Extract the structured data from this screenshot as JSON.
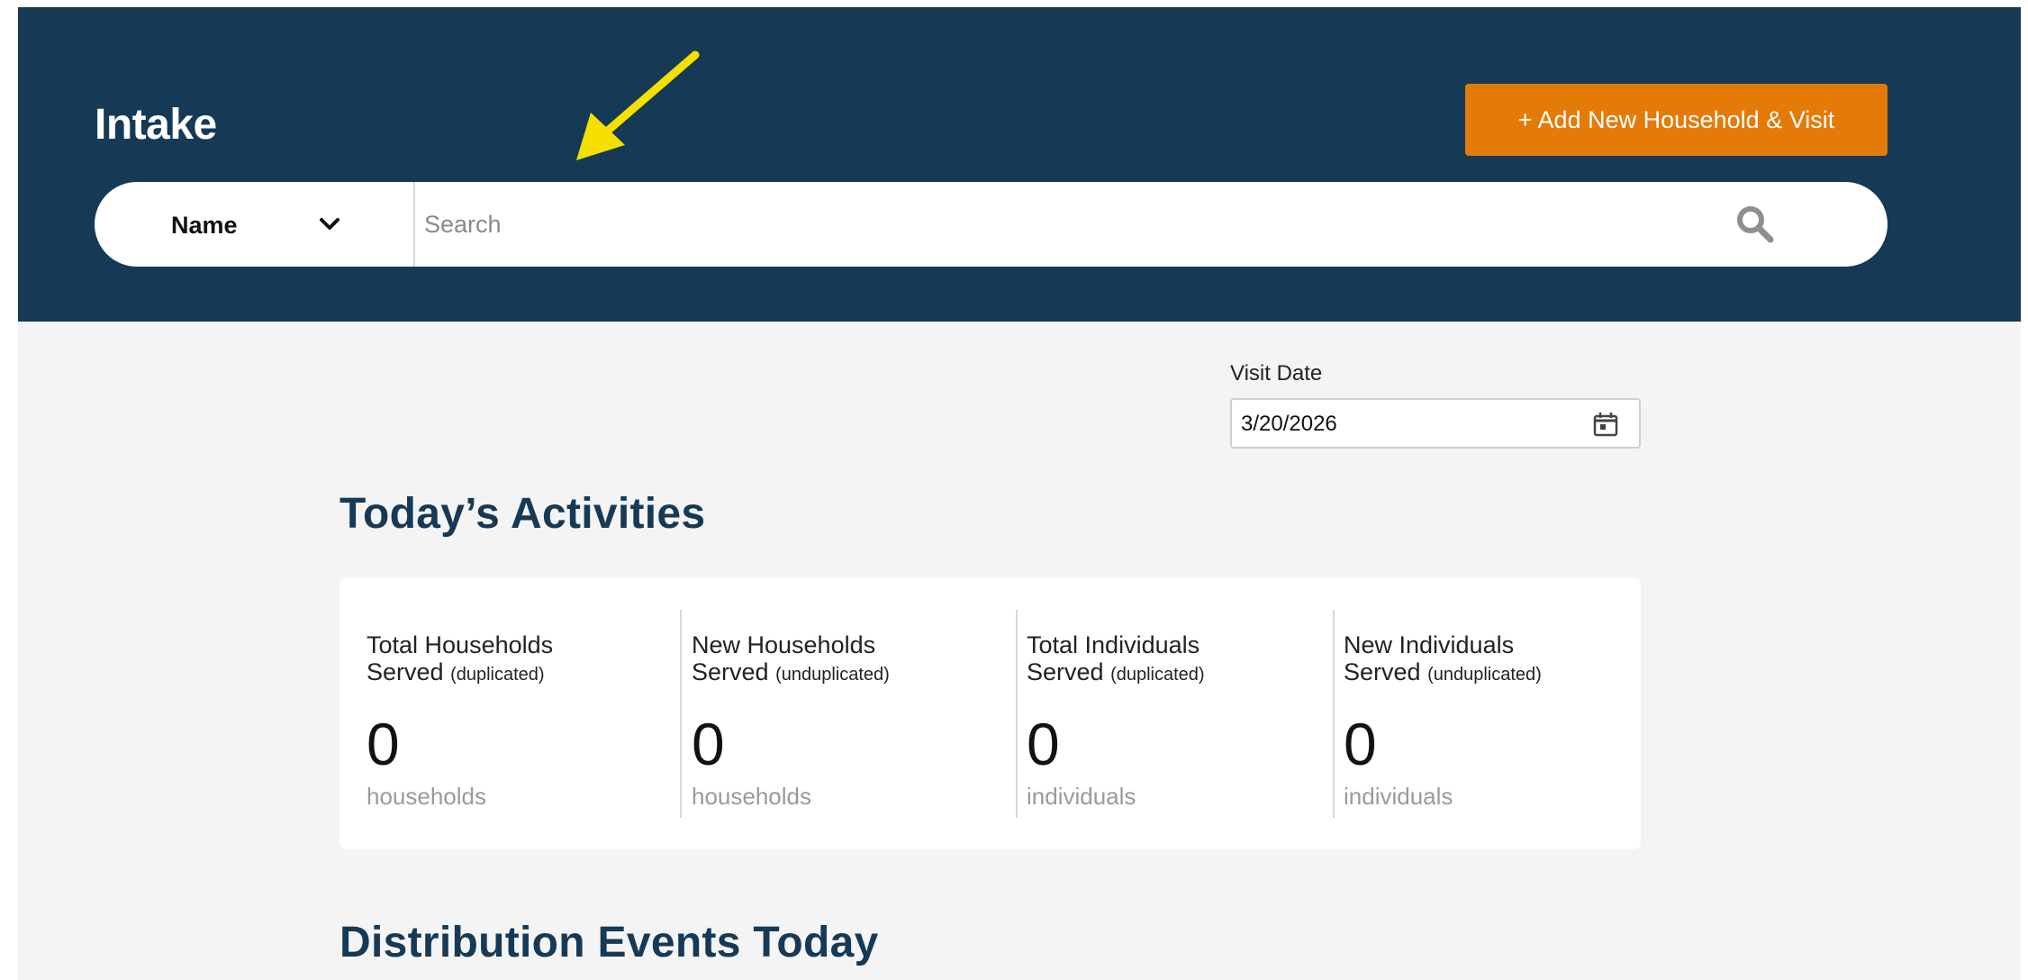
{
  "header": {
    "title": "Intake",
    "add_button_label": "+ Add New Household & Visit",
    "accent_color": "#e47a07",
    "background_color": "#163a56",
    "arrow_color": "#f5e000"
  },
  "search": {
    "type_label": "Name",
    "placeholder": "Search",
    "value": ""
  },
  "visit_date": {
    "label": "Visit Date",
    "value": "3/20/2026"
  },
  "activities": {
    "title": "Today’s Activities",
    "stats": [
      {
        "label_line1": "Total Households",
        "label_line2": "Served",
        "qualifier": "(duplicated)",
        "value": "0",
        "unit": "households"
      },
      {
        "label_line1": "New Households",
        "label_line2": "Served",
        "qualifier": "(unduplicated)",
        "value": "0",
        "unit": "households"
      },
      {
        "label_line1": "Total Individuals",
        "label_line2": "Served",
        "qualifier": "(duplicated)",
        "value": "0",
        "unit": "individuals"
      },
      {
        "label_line1": "New Individuals",
        "label_line2": "Served",
        "qualifier": "(unduplicated)",
        "value": "0",
        "unit": "individuals"
      }
    ]
  },
  "events": {
    "title": "Distribution Events Today"
  }
}
